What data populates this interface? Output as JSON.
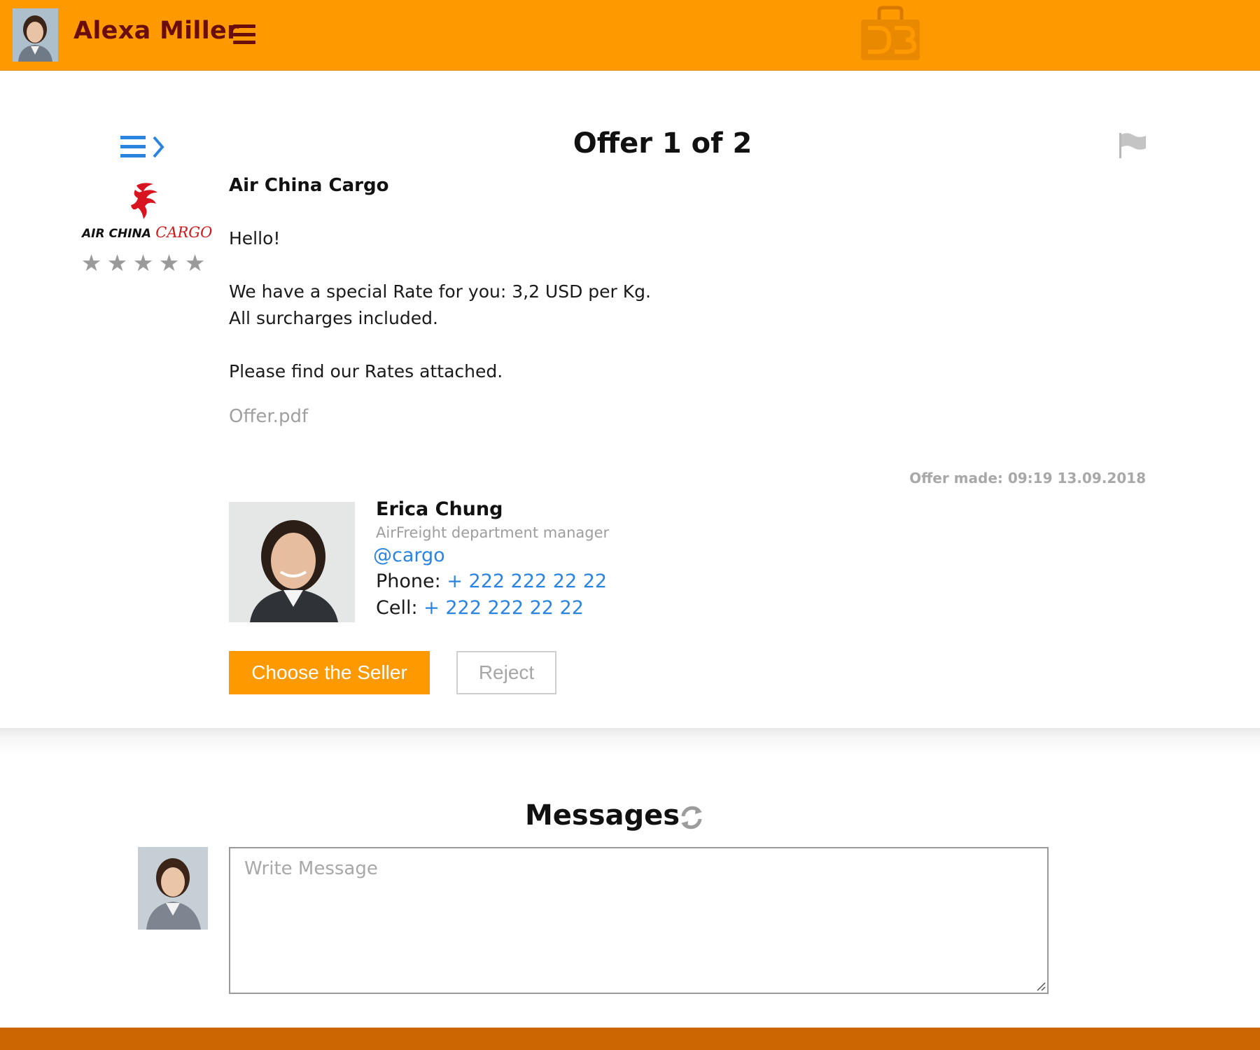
{
  "header": {
    "user_name": "Alexa Miller",
    "accent_color": "#ff9900",
    "user_name_color": "#6a0d0d",
    "brand_logo_icon": "shopping-bag-db-logo-icon",
    "menu_icon": "hamburger-menu-icon"
  },
  "offer": {
    "title": "Offer 1 of 2",
    "list_toggle_icon": "list-chevron-icon",
    "flag_icon": "flag-icon",
    "seller_company": "Air China Cargo",
    "logo": {
      "text_a": "AIR CHINA",
      "text_b": "CARGO",
      "icon": "phoenix-logo-icon"
    },
    "rating": {
      "value": 0,
      "max": 5,
      "star_color": "#9a9a9a"
    },
    "greeting": "Hello!",
    "rate_line": "We have a special Rate for you: 3,2 USD per Kg.",
    "surcharges_line": "All surcharges included.",
    "attached_line": "Please find our Rates attached.",
    "attachment": "Offer.pdf",
    "made_label": "Offer made: 09:19 13.09.2018"
  },
  "contact": {
    "name": "Erica Chung",
    "role": "AirFreight department manager",
    "handle": "@cargo",
    "phone_label": "Phone:",
    "phone": "+ 222 222 22 22",
    "cell_label": "Cell:",
    "cell": "+ 222 222 22 22",
    "link_color": "#2a84e0"
  },
  "actions": {
    "choose_label": "Choose the Seller",
    "reject_label": "Reject"
  },
  "messages": {
    "title": "Messages",
    "refresh_icon": "refresh-icon",
    "input_placeholder": "Write Message"
  },
  "footer": {
    "color": "#cc6600"
  }
}
